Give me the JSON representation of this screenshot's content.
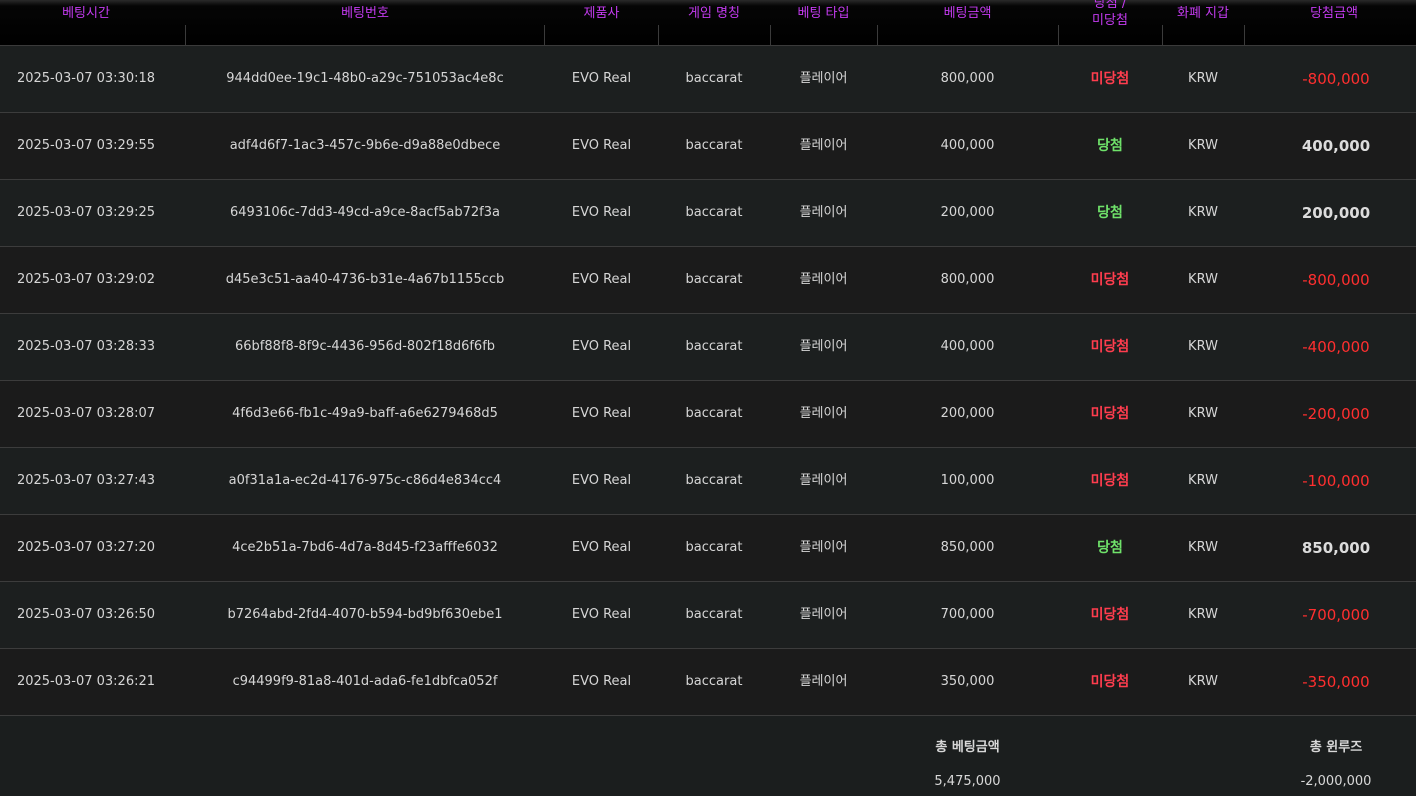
{
  "header": {
    "bet_time": "베팅시간",
    "bet_id": "베팅번호",
    "provider": "제품사",
    "game_name": "게임 명칭",
    "bet_type": "베팅 타입",
    "bet_amount": "베팅금액",
    "result_line1": "당첨 /",
    "result_line2": "미당첨",
    "currency": "화폐 지갑",
    "payout": "당첨금액"
  },
  "rows": [
    {
      "time": "2025-03-07 03:30:18",
      "id": "944dd0ee-19c1-48b0-a29c-751053ac4e8c",
      "provider": "EVO Real",
      "game": "baccarat",
      "type": "플레이어",
      "amount": "800,000",
      "result": "미당첨",
      "outcome": "lose",
      "currency": "KRW",
      "payout": "-800,000"
    },
    {
      "time": "2025-03-07 03:29:55",
      "id": "adf4d6f7-1ac3-457c-9b6e-d9a88e0dbece",
      "provider": "EVO Real",
      "game": "baccarat",
      "type": "플레이어",
      "amount": "400,000",
      "result": "당첨",
      "outcome": "win",
      "currency": "KRW",
      "payout": "400,000"
    },
    {
      "time": "2025-03-07 03:29:25",
      "id": "6493106c-7dd3-49cd-a9ce-8acf5ab72f3a",
      "provider": "EVO Real",
      "game": "baccarat",
      "type": "플레이어",
      "amount": "200,000",
      "result": "당첨",
      "outcome": "win",
      "currency": "KRW",
      "payout": "200,000"
    },
    {
      "time": "2025-03-07 03:29:02",
      "id": "d45e3c51-aa40-4736-b31e-4a67b1155ccb",
      "provider": "EVO Real",
      "game": "baccarat",
      "type": "플레이어",
      "amount": "800,000",
      "result": "미당첨",
      "outcome": "lose",
      "currency": "KRW",
      "payout": "-800,000"
    },
    {
      "time": "2025-03-07 03:28:33",
      "id": "66bf88f8-8f9c-4436-956d-802f18d6f6fb",
      "provider": "EVO Real",
      "game": "baccarat",
      "type": "플레이어",
      "amount": "400,000",
      "result": "미당첨",
      "outcome": "lose",
      "currency": "KRW",
      "payout": "-400,000"
    },
    {
      "time": "2025-03-07 03:28:07",
      "id": "4f6d3e66-fb1c-49a9-baff-a6e6279468d5",
      "provider": "EVO Real",
      "game": "baccarat",
      "type": "플레이어",
      "amount": "200,000",
      "result": "미당첨",
      "outcome": "lose",
      "currency": "KRW",
      "payout": "-200,000"
    },
    {
      "time": "2025-03-07 03:27:43",
      "id": "a0f31a1a-ec2d-4176-975c-c86d4e834cc4",
      "provider": "EVO Real",
      "game": "baccarat",
      "type": "플레이어",
      "amount": "100,000",
      "result": "미당첨",
      "outcome": "lose",
      "currency": "KRW",
      "payout": "-100,000"
    },
    {
      "time": "2025-03-07 03:27:20",
      "id": "4ce2b51a-7bd6-4d7a-8d45-f23afffe6032",
      "provider": "EVO Real",
      "game": "baccarat",
      "type": "플레이어",
      "amount": "850,000",
      "result": "당첨",
      "outcome": "win",
      "currency": "KRW",
      "payout": "850,000"
    },
    {
      "time": "2025-03-07 03:26:50",
      "id": "b7264abd-2fd4-4070-b594-bd9bf630ebe1",
      "provider": "EVO Real",
      "game": "baccarat",
      "type": "플레이어",
      "amount": "700,000",
      "result": "미당첨",
      "outcome": "lose",
      "currency": "KRW",
      "payout": "-700,000"
    },
    {
      "time": "2025-03-07 03:26:21",
      "id": "c94499f9-81a8-401d-ada6-fe1dbfca052f",
      "provider": "EVO Real",
      "game": "baccarat",
      "type": "플레이어",
      "amount": "350,000",
      "result": "미당첨",
      "outcome": "lose",
      "currency": "KRW",
      "payout": "-350,000"
    }
  ],
  "summary": {
    "total_bet_label": "총 베팅금액",
    "total_bet_value": "5,475,000",
    "total_winloss_label": "총 윈루즈",
    "total_winloss_value": "-2,000,000"
  },
  "colors": {
    "header_text": "#c43bf0",
    "win": "#6fe26a",
    "lose": "#ff3d4e",
    "negative_payout": "#ff2f2f"
  }
}
